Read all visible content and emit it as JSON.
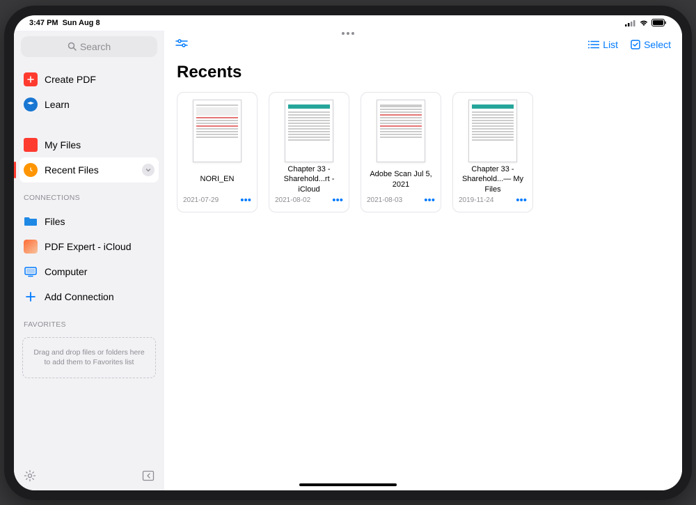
{
  "status": {
    "time": "3:47 PM",
    "date": "Sun Aug 8"
  },
  "sidebar": {
    "search_placeholder": "Search",
    "items": {
      "create_pdf": "Create PDF",
      "learn": "Learn",
      "my_files": "My Files",
      "recent_files": "Recent Files"
    },
    "connections_header": "CONNECTIONS",
    "connections": {
      "files": "Files",
      "pdf_expert_icloud": "PDF Expert - iCloud",
      "computer": "Computer",
      "add_connection": "Add Connection"
    },
    "favorites_header": "FAVORITES",
    "favorites_drop": "Drag and drop files or folders here to add them to Favorites list"
  },
  "toolbar": {
    "list_label": "List",
    "select_label": "Select"
  },
  "main": {
    "title": "Recents",
    "files": [
      {
        "title": "NORI_EN",
        "date": "2021-07-29",
        "kind": "form"
      },
      {
        "title": "Chapter 33 - Sharehold...rt - iCloud",
        "date": "2021-08-02",
        "kind": "doc"
      },
      {
        "title": "Adobe Scan Jul 5, 2021",
        "date": "2021-08-03",
        "kind": "form"
      },
      {
        "title": "Chapter 33 - Sharehold...— My Files",
        "date": "2019-11-24",
        "kind": "doc"
      }
    ]
  }
}
